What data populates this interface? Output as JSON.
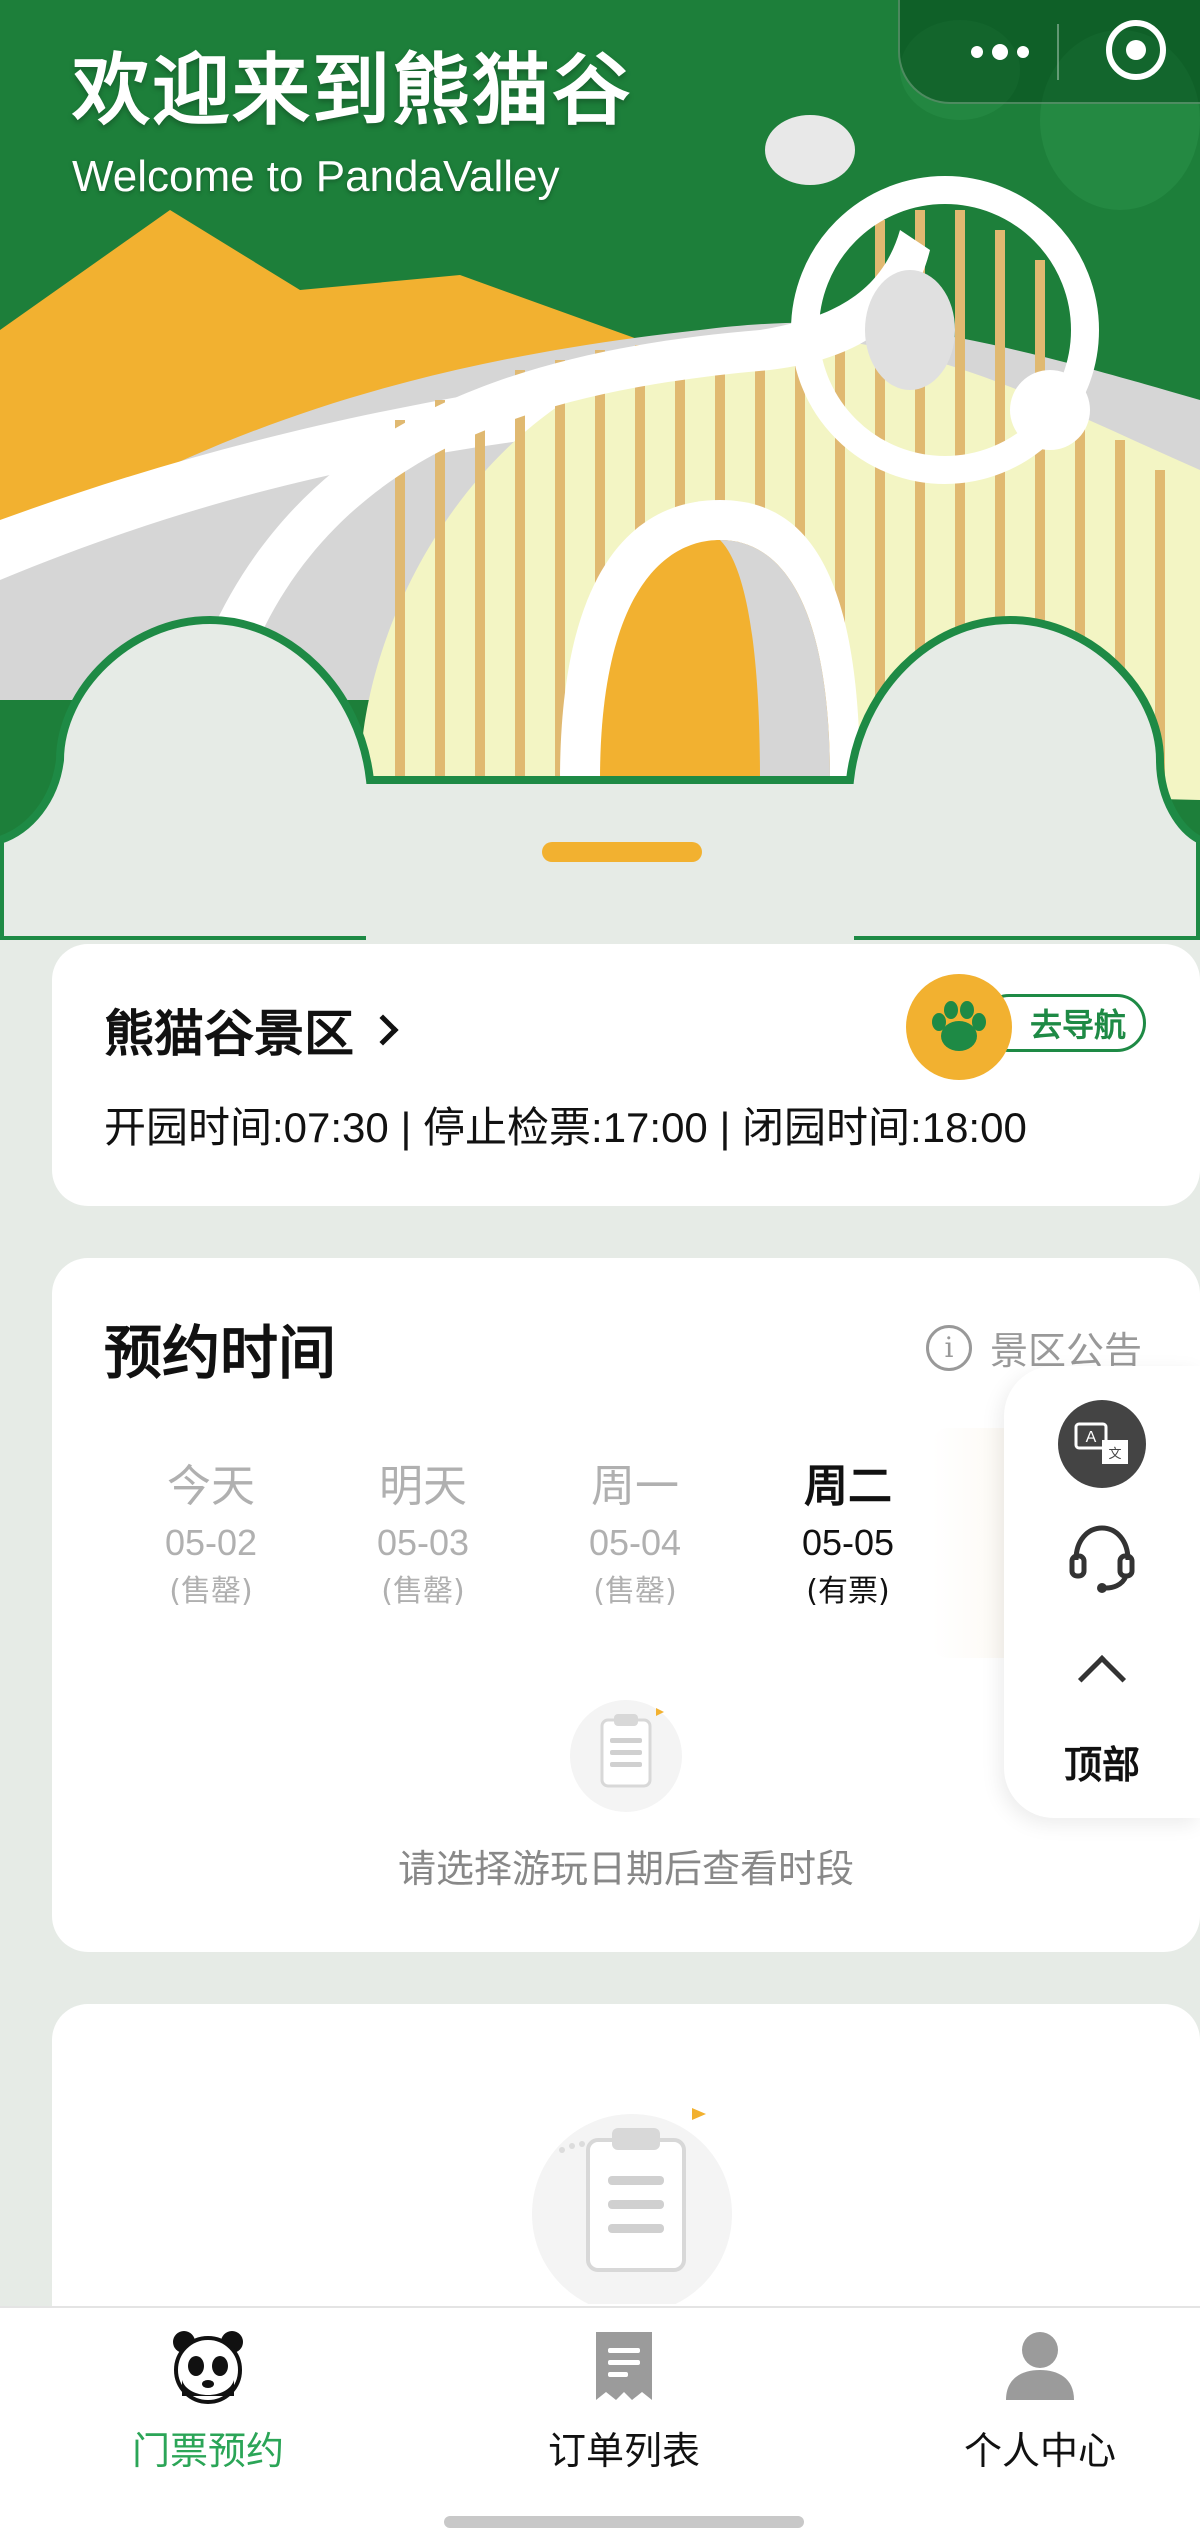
{
  "hero": {
    "title": "欢迎来到熊猫谷",
    "subtitle": "Welcome to PandaValley"
  },
  "capsule": {
    "more_icon": "more-dots-icon",
    "close_icon": "mini-program-close-icon"
  },
  "scenic": {
    "name": "熊猫谷景区",
    "hours": "开园时间:07:30 | 停止检票:17:00 | 闭园时间:18:00",
    "nav_label": "去导航",
    "nav_icon": "paw-icon"
  },
  "reserve": {
    "title": "预约时间",
    "notice_label": "景区公告",
    "dates": [
      {
        "day": "今天",
        "date": "05-02",
        "status": "(售罄)",
        "available": false
      },
      {
        "day": "明天",
        "date": "05-03",
        "status": "(售罄)",
        "available": false
      },
      {
        "day": "周一",
        "date": "05-04",
        "status": "(售罄)",
        "available": false
      },
      {
        "day": "周二",
        "date": "05-05",
        "status": "(有票)",
        "available": true
      }
    ],
    "empty_text": "请选择游玩日期后查看时段"
  },
  "side_menu": {
    "translate_icon": "translate-icon",
    "service_icon": "headset-icon",
    "top_label": "顶部"
  },
  "tabbar": {
    "tabs": [
      {
        "label": "门票预约",
        "icon": "panda-icon",
        "active": true
      },
      {
        "label": "订单列表",
        "icon": "receipt-icon",
        "active": false
      },
      {
        "label": "个人中心",
        "icon": "user-icon",
        "active": false
      }
    ]
  },
  "colors": {
    "brand_green": "#1e8a45",
    "active_tab_green": "#2ba557",
    "accent_yellow": "#f2b130",
    "page_bg": "#e6ebe6"
  }
}
